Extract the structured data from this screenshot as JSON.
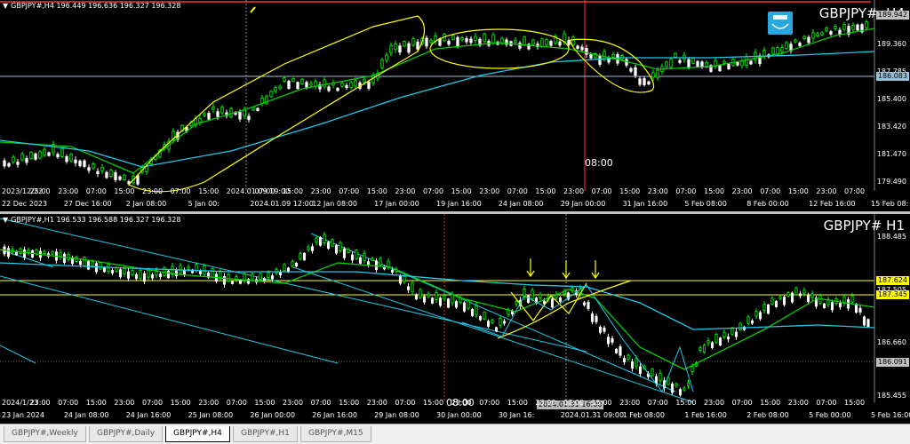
{
  "top": {
    "header": "GBPJPY#,H4  196.449 196.636 196.327 196.328",
    "symbol": "GBPJPY#, H4",
    "prices": [
      "189.942",
      "189.360",
      "187.785",
      "185.400",
      "183.420",
      "181.470",
      "179.490"
    ],
    "hline_tag": "186.083",
    "bid_tag": "189.942",
    "times": [
      "2023/12/22",
      "25:00",
      "23:00",
      "07:00",
      "15:00",
      "23:00",
      "07:00",
      "15:00",
      "2024.01.09 19:00",
      "07:00",
      "15:00",
      "23:00",
      "07:00",
      "15:00",
      "23:00",
      "07:00",
      "15:00",
      "23:00",
      "07:00",
      "15:00",
      "23:00",
      "07:00",
      "15:00",
      "23:00",
      "07:00",
      "15:00",
      "23:00",
      "07:00",
      "15:00",
      "23:00",
      "07:00"
    ],
    "dates": [
      "22 Dec 2023",
      "27 Dec 16:00",
      "2 Jan 08:00",
      "5 Jan 00:",
      "2024.01.09 12:00",
      "12 Jan 08:00",
      "17 Jan 00:00",
      "19 Jan 16:00",
      "24 Jan 08:00",
      "29 Jan 00:00",
      "31 Jan 16:00",
      "5 Feb 08:00",
      "8 Feb 00:00",
      "12 Feb 16:00",
      "15 Feb 08:"
    ],
    "note": "08:00"
  },
  "bottom": {
    "header": "GBPJPY#,H1  196.533 196.588 196.327 196.328",
    "symbol": "GBPJPY# H1",
    "prices": [
      "188.485",
      "187.505",
      "186.660",
      "185.455"
    ],
    "tag1": "187.624",
    "tag2": "187.345",
    "tag3": "186.091",
    "times": [
      "2024/1/23",
      "23:00",
      "07:00",
      "15:00",
      "23:00",
      "07:00",
      "15:00",
      "23:00",
      "07:00",
      "15:00",
      "23:00",
      "07:00",
      "15:00",
      "23:00",
      "07:00",
      "15:00",
      "23:00",
      "07:00",
      "15:00",
      "23:00",
      "07:00",
      "15:00",
      "23:00",
      "07:00",
      "15:00",
      "23:00",
      "07:00",
      "15:00",
      "23:00",
      "07:00",
      "15:00"
    ],
    "dates": [
      "23 Jan 2024",
      "24 Jan 08:00",
      "24 Jan 16:00",
      "25 Jan 08:00",
      "26 Jan 00:00",
      "26 Jan 16:00",
      "29 Jan 08:00",
      "30 Jan 00:00",
      "30 Jan 16:",
      "2024.01.31 09:00",
      "1 Feb 08:00",
      "1 Feb 16:00",
      "2 Feb 08:00",
      "5 Feb 00:00",
      "5 Feb 16:00"
    ],
    "box_time": "2024.01.31 16:00",
    "note": "08:00"
  },
  "tabs": [
    "GBPJPY#,Weekly",
    "GBPJPY#,Daily",
    "GBPJPY#,H4",
    "GBPJPY#,H1",
    "GBPJPY#,M15"
  ],
  "active_tab": "GBPJPY#,H4",
  "colors": {
    "bull": "#00ff00",
    "bear": "#ffffff",
    "ma_fast": "#00cc00",
    "ma_slow": "#22c8e8",
    "draw": "#ffff00",
    "hline": "#9ac0d8",
    "redline": "#ff3030"
  }
}
